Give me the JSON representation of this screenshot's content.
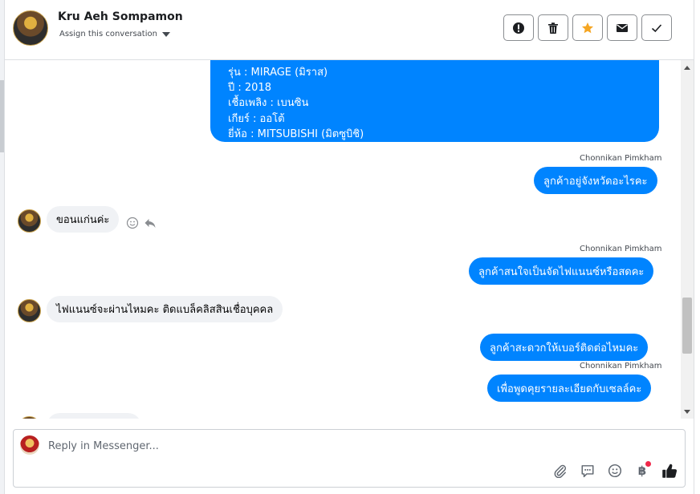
{
  "header": {
    "contact_name": "Kru Aeh Sompamon",
    "assign_label": "Assign this conversation",
    "toolbar": [
      {
        "name": "mark-spam-button",
        "icon": "exclamation-icon"
      },
      {
        "name": "delete-button",
        "icon": "trash-icon"
      },
      {
        "name": "star-button",
        "icon": "star-icon"
      },
      {
        "name": "mark-unread-button",
        "icon": "envelope-icon"
      },
      {
        "name": "mark-done-button",
        "icon": "checkmark-icon"
      }
    ]
  },
  "car_details": {
    "lines": [
      "รุ่น : MIRAGE (มิราส)",
      "ปี : 2018",
      "เชื้อเพลิง : เบนซิน",
      "เกียร์ : ออโต้",
      "ยี่ห้อ : MITSUBISHI (มิตซูบิชิ)"
    ]
  },
  "messages": [
    {
      "sender": "Chonnikan Pimkham",
      "text": "ลูกค้าอยู่จังหวัดอะไรคะ"
    },
    {
      "text": "ขอนแก่นค่ะ"
    },
    {
      "sender": "Chonnikan Pimkham",
      "text": "ลูกค้าสนใจเป็นจัดไฟแนนซ์หรือสดคะ"
    },
    {
      "text": "ไฟแนนซ์จะผ่านไหมคะ ติดแบล็คลิสสินเชื่อบุคคล"
    },
    {
      "text": "ลูกค้าสะดวกให้เบอร์ติดต่อไหมคะ"
    },
    {
      "sender": "Chonnikan Pimkham",
      "text": "เพื่อพูดคุยรายละเอียดกับเซลล์คะ"
    }
  ],
  "composer": {
    "placeholder": "Reply in Messenger...",
    "icons": [
      "paperclip-icon",
      "saved-reply-icon",
      "emoji-icon",
      "baht-payment-icon",
      "thumbs-up-icon"
    ],
    "baht_symbol": "฿"
  },
  "colors": {
    "outgoing_bubble": "#0084ff",
    "incoming_bubble": "#f0f2f5",
    "star": "#f5a623"
  }
}
